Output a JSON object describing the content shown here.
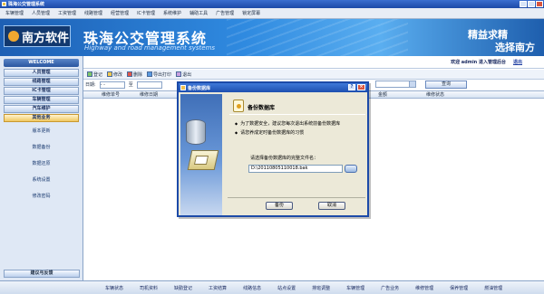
{
  "window": {
    "title": "珠海公交管理系统"
  },
  "menu": [
    "车辆管理",
    "人员管理",
    "工资管理",
    "线路管理",
    "经营管理",
    "IC卡管理",
    "系统维护",
    "辅助工具",
    "广告管理",
    "锁定屏幕"
  ],
  "banner": {
    "logo": "南方软件",
    "system_name": "珠海公交管理系统",
    "subtitle": "Highway and road management systems",
    "slogan1": "精益求精",
    "slogan2": "选择南方"
  },
  "sidebar": {
    "welcome": "WELCOME",
    "modules": [
      {
        "label": "人员管理"
      },
      {
        "label": "线路管理"
      },
      {
        "label": "IC卡管理"
      },
      {
        "label": "车辆管理"
      },
      {
        "label": "汽车维护"
      },
      {
        "label": "其他业务"
      }
    ],
    "subitems": [
      "版本更新",
      "数据备份",
      "数据还原",
      "系统设置",
      "修改密码"
    ],
    "bottom": "建议与反馈"
  },
  "userbar": {
    "welcome": "欢迎 admin 进入管理后台",
    "logout": "退出"
  },
  "toolbar": {
    "add": "登记",
    "edit": "修改",
    "del": "删除",
    "export": "导出打印",
    "out": "退出"
  },
  "filter": {
    "date_label": "日期:",
    "date_value": "-  -",
    "to": "至",
    "query": "查询"
  },
  "grid": {
    "col_vehicle": "维修单号",
    "col_date": "维修日期",
    "col_amount": "金额",
    "col_status": "维修状态"
  },
  "dialog": {
    "title": "备份数据库",
    "heading": "备份数据库",
    "bullet1": "为了数据安全，建议您每次退出系统前备份数据库",
    "bullet2": "请您养成定时备份数据库的习惯",
    "prompt": "请选择备份数据库的完整文件名：",
    "path": "D:\\20110805110018.bak",
    "ok": "备份",
    "cancel": "取消"
  },
  "footer": [
    "车辆状态",
    "司机资料",
    "缺勤登记",
    "工资结算",
    "线路信息",
    "站点设置",
    "排班调整",
    "车辆管理",
    "广告业务",
    "维修管理",
    "保养管理",
    "燃油管理"
  ]
}
